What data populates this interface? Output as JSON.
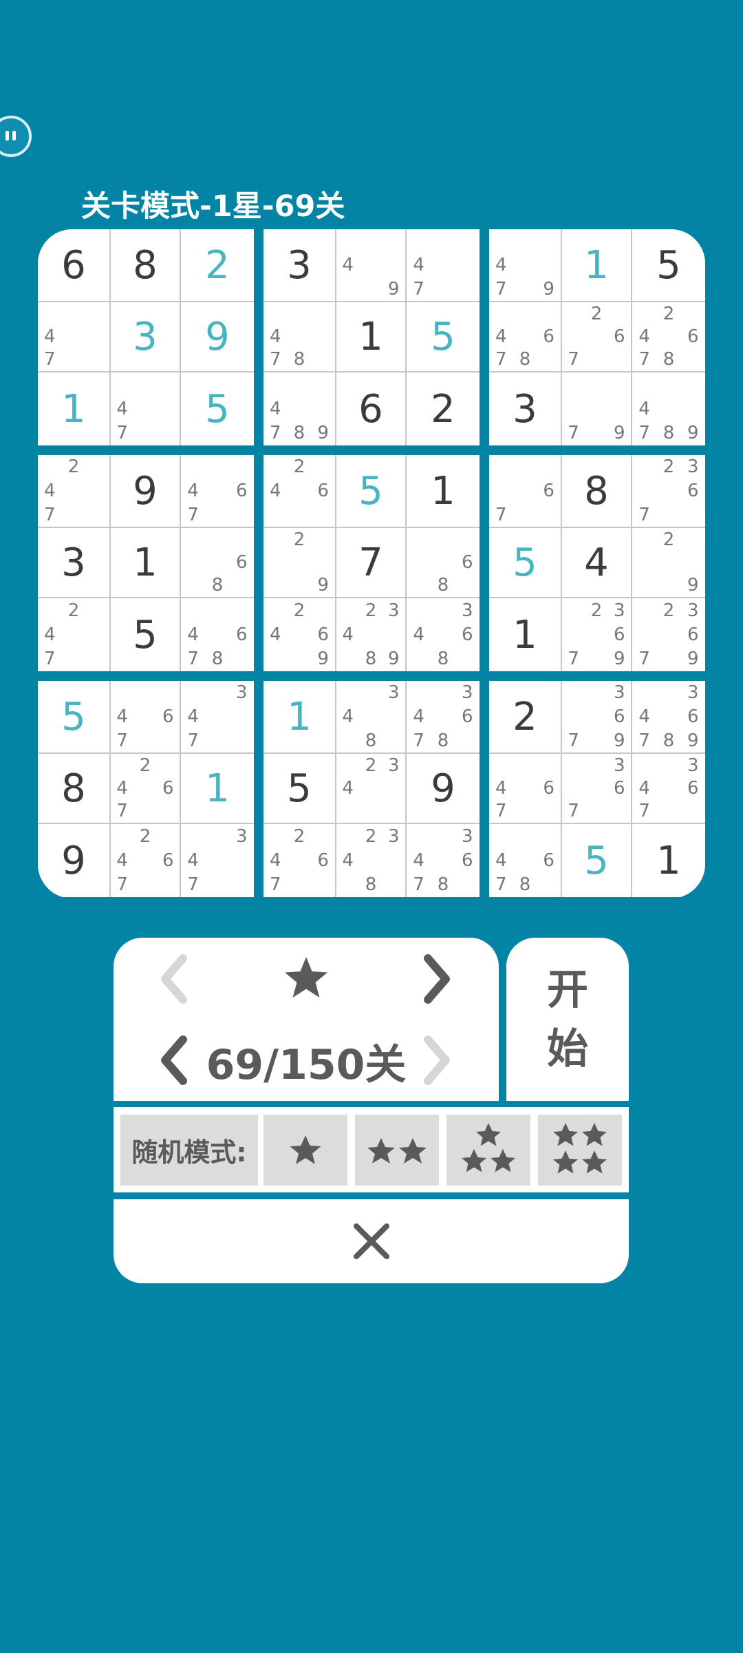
{
  "header": {
    "level_title": "关卡模式-1星-69关"
  },
  "board": {
    "cells": [
      [
        {
          "v": "6"
        },
        {
          "v": "8"
        },
        {
          "v": "2",
          "u": true
        },
        {
          "v": "3"
        },
        {
          "n": "49"
        },
        {
          "n": "47"
        },
        {
          "n": "479"
        },
        {
          "v": "1",
          "u": true
        },
        {
          "v": "5"
        }
      ],
      [
        {
          "n": "47"
        },
        {
          "v": "3",
          "u": true
        },
        {
          "v": "9",
          "u": true
        },
        {
          "n": "478"
        },
        {
          "v": "1"
        },
        {
          "v": "5",
          "u": true
        },
        {
          "n": "4678"
        },
        {
          "n": "267"
        },
        {
          "n": "24678"
        }
      ],
      [
        {
          "v": "1",
          "u": true
        },
        {
          "n": "47"
        },
        {
          "v": "5",
          "u": true
        },
        {
          "n": "4789"
        },
        {
          "v": "6"
        },
        {
          "v": "2"
        },
        {
          "v": "3"
        },
        {
          "n": "79"
        },
        {
          "n": "4789"
        }
      ],
      [
        {
          "n": "247"
        },
        {
          "v": "9"
        },
        {
          "n": "467"
        },
        {
          "n": "246"
        },
        {
          "v": "5",
          "u": true
        },
        {
          "v": "1"
        },
        {
          "n": "67"
        },
        {
          "v": "8"
        },
        {
          "n": "2367"
        }
      ],
      [
        {
          "v": "3"
        },
        {
          "v": "1"
        },
        {
          "n": "68"
        },
        {
          "n": "29"
        },
        {
          "v": "7"
        },
        {
          "n": "68"
        },
        {
          "v": "5",
          "u": true
        },
        {
          "v": "4"
        },
        {
          "n": "29"
        }
      ],
      [
        {
          "n": "247"
        },
        {
          "v": "5"
        },
        {
          "n": "4678"
        },
        {
          "n": "2469"
        },
        {
          "n": "23489"
        },
        {
          "n": "3468"
        },
        {
          "v": "1"
        },
        {
          "n": "23679"
        },
        {
          "n": "23679"
        }
      ],
      [
        {
          "v": "5",
          "u": true
        },
        {
          "n": "467"
        },
        {
          "n": "347"
        },
        {
          "v": "1",
          "u": true
        },
        {
          "n": "348"
        },
        {
          "n": "34678"
        },
        {
          "v": "2"
        },
        {
          "n": "3679"
        },
        {
          "n": "346789"
        }
      ],
      [
        {
          "v": "8"
        },
        {
          "n": "2467"
        },
        {
          "v": "1",
          "u": true
        },
        {
          "v": "5"
        },
        {
          "n": "234"
        },
        {
          "v": "9"
        },
        {
          "n": "467"
        },
        {
          "n": "367"
        },
        {
          "n": "3467"
        }
      ],
      [
        {
          "v": "9"
        },
        {
          "n": "2467"
        },
        {
          "n": "347"
        },
        {
          "n": "2467"
        },
        {
          "n": "2348"
        },
        {
          "n": "34678"
        },
        {
          "n": "4678"
        },
        {
          "v": "5",
          "u": true
        },
        {
          "v": "1"
        }
      ]
    ]
  },
  "controls": {
    "level_counter": "69/150关",
    "difficulty_stars": 1,
    "start_label": "开始"
  },
  "random_mode": {
    "label": "随机模式:",
    "options": [
      {
        "stars": 1
      },
      {
        "stars": 2
      },
      {
        "stars": 3
      },
      {
        "stars": 4
      }
    ]
  },
  "colors": {
    "background": "#0384a4",
    "given_digit": "#3b3b3b",
    "entered_digit": "#47b5c0",
    "note": "#777777",
    "button_text": "#5a5a5a",
    "arrow_enabled": "#5a5a5a",
    "arrow_disabled": "#d6d6d6"
  }
}
